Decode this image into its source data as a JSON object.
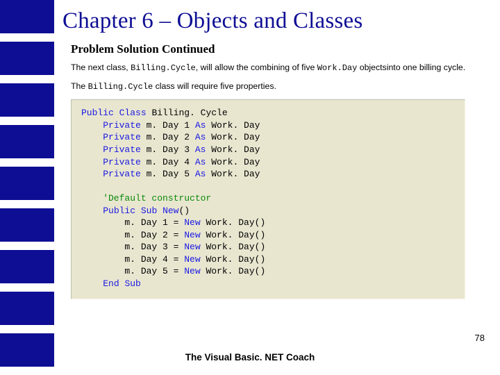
{
  "sidebar": {
    "block_count": 9
  },
  "title": "Chapter 6 – Objects and Classes",
  "section": "Problem Solution Continued",
  "para1": {
    "pre": "The next class, ",
    "code1": "Billing.Cycle",
    "mid": ", will allow the combining of five ",
    "code2": "Work.Day",
    "post": " objectsinto one billing cycle."
  },
  "para2": {
    "pre": "The ",
    "code1": "Billing.Cycle",
    "post": " class will require five properties."
  },
  "code": {
    "l01a": "Public",
    "l01b": " ",
    "l01c": "Class",
    "l01d": " Billing. Cycle",
    "l02a": "    ",
    "l02b": "Private",
    "l02c": " m. Day 1 ",
    "l02d": "As",
    "l02e": " Work. Day",
    "l03a": "    ",
    "l03b": "Private",
    "l03c": " m. Day 2 ",
    "l03d": "As",
    "l03e": " Work. Day",
    "l04a": "    ",
    "l04b": "Private",
    "l04c": " m. Day 3 ",
    "l04d": "As",
    "l04e": " Work. Day",
    "l05a": "    ",
    "l05b": "Private",
    "l05c": " m. Day 4 ",
    "l05d": "As",
    "l05e": " Work. Day",
    "l06a": "    ",
    "l06b": "Private",
    "l06c": " m. Day 5 ",
    "l06d": "As",
    "l06e": " Work. Day",
    "blank": " ",
    "l08": "    'Default constructor",
    "l09a": "    ",
    "l09b": "Public",
    "l09c": " ",
    "l09d": "Sub",
    "l09e": " ",
    "l09f": "New",
    "l09g": "()",
    "l10a": "        m. Day 1 = ",
    "l10b": "New",
    "l10c": " Work. Day()",
    "l11a": "        m. Day 2 = ",
    "l11b": "New",
    "l11c": " Work. Day()",
    "l12a": "        m. Day 3 = ",
    "l12b": "New",
    "l12c": " Work. Day()",
    "l13a": "        m. Day 4 = ",
    "l13b": "New",
    "l13c": " Work. Day()",
    "l14a": "        m. Day 5 = ",
    "l14b": "New",
    "l14c": " Work. Day()",
    "l15a": "    ",
    "l15b": "End",
    "l15c": " ",
    "l15d": "Sub"
  },
  "page_number": "78",
  "footer": "The Visual Basic. NET Coach"
}
